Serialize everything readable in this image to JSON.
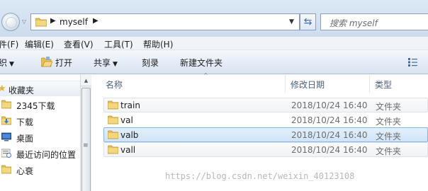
{
  "window": {
    "title": "myself"
  },
  "address_bar": {
    "breadcrumbs": [
      "myself"
    ],
    "folder_icon": "folder-icon"
  },
  "search": {
    "placeholder": "搜索 myself"
  },
  "menu": {
    "items": [
      "件(F)",
      "编辑(E)",
      "查看(V)",
      "工具(T)",
      "帮助(H)"
    ]
  },
  "toolbar": {
    "organize": "织",
    "open": "打开",
    "share": "共享",
    "burn": "刻录",
    "new_folder": "新建文件夹"
  },
  "nav": {
    "favorites": "收藏夹",
    "items": [
      {
        "label": "2345下载",
        "icon": "folder-icon"
      },
      {
        "label": "下载",
        "icon": "download-folder-icon"
      },
      {
        "label": "桌面",
        "icon": "desktop-icon"
      },
      {
        "label": "最近访问的位置",
        "icon": "recent-places-icon"
      },
      {
        "label": "心衰",
        "icon": "folder-icon"
      }
    ]
  },
  "columns": {
    "name": "名称",
    "modified": "修改日期",
    "type": "类型"
  },
  "files": [
    {
      "name": "train",
      "modified": "2018/10/24 16:40",
      "type": "文件夹",
      "state": "hover"
    },
    {
      "name": "val",
      "modified": "2018/10/24 16:40",
      "type": "文件夹",
      "state": "normal"
    },
    {
      "name": "valb",
      "modified": "2018/10/24 16:40",
      "type": "文件夹",
      "state": "selected"
    },
    {
      "name": "vall",
      "modified": "2018/10/24 16:40",
      "type": "文件夹",
      "state": "hover"
    }
  ],
  "watermark": "https://blog.csdn.net/weixin_40123108",
  "colors": {
    "folder": "#e8c05a",
    "selection": "#cfe4f8",
    "selection_border": "#83b5e4",
    "header_text": "#4c607a"
  }
}
